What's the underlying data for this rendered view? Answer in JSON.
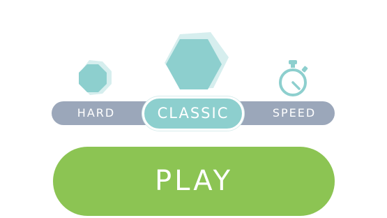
{
  "modes": {
    "hard_label": "HARD",
    "classic_label": "CLASSIC",
    "speed_label": "SPEED",
    "selected": "CLASSIC"
  },
  "play": {
    "label": "PLAY"
  },
  "icons": {
    "hard": "octagon-icon",
    "classic": "hexagon-icon",
    "speed": "stopwatch-icon"
  },
  "colors": {
    "teal": "#8dcfce",
    "track": "#9ba7ba",
    "play_green": "#8cc453"
  }
}
